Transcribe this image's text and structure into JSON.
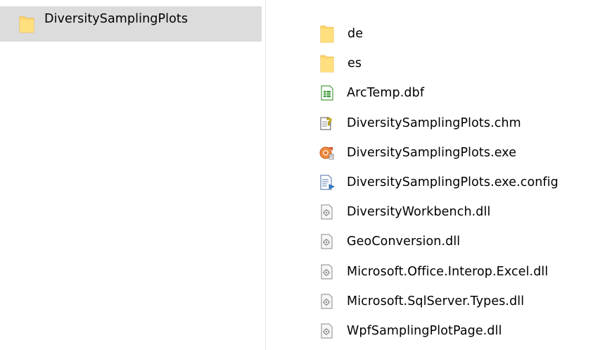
{
  "tree": {
    "selected_folder": {
      "label": "DiversitySamplingPlots",
      "icon": "folder-icon"
    }
  },
  "files": [
    {
      "name": "de",
      "icon": "folder-icon",
      "kind": "folder"
    },
    {
      "name": "es",
      "icon": "folder-icon",
      "kind": "folder"
    },
    {
      "name": "ArcTemp.dbf",
      "icon": "dbf-file-icon",
      "kind": "file"
    },
    {
      "name": "DiversitySamplingPlots.chm",
      "icon": "help-file-icon",
      "kind": "file"
    },
    {
      "name": "DiversitySamplingPlots.exe",
      "icon": "exe-file-icon",
      "kind": "file"
    },
    {
      "name": "DiversitySamplingPlots.exe.config",
      "icon": "config-file-icon",
      "kind": "file"
    },
    {
      "name": "DiversityWorkbench.dll",
      "icon": "dll-file-icon",
      "kind": "file"
    },
    {
      "name": "GeoConversion.dll",
      "icon": "dll-file-icon",
      "kind": "file"
    },
    {
      "name": "Microsoft.Office.Interop.Excel.dll",
      "icon": "dll-file-icon",
      "kind": "file"
    },
    {
      "name": "Microsoft.SqlServer.Types.dll",
      "icon": "dll-file-icon",
      "kind": "file"
    },
    {
      "name": "WpfSamplingPlotPage.dll",
      "icon": "dll-file-icon",
      "kind": "file"
    }
  ],
  "colors": {
    "selection_background": "#dcdcdc",
    "folder_yellow": "#ffd86b",
    "splitter": "#e3e3e3"
  }
}
